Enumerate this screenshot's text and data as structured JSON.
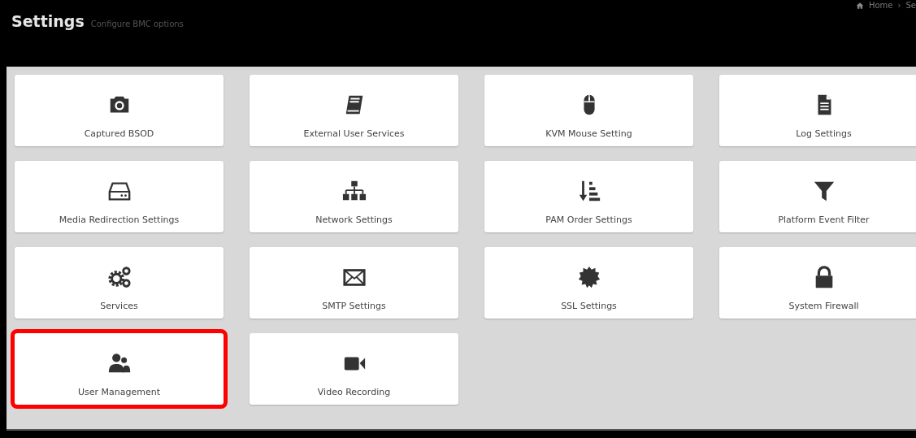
{
  "header": {
    "title": "Settings",
    "subtitle": "Configure BMC options",
    "breadcrumb": [
      "Home",
      "›",
      "Se"
    ]
  },
  "tiles": [
    {
      "label": "Captured BSOD",
      "highlighted": false
    },
    {
      "label": "External User Services",
      "highlighted": false
    },
    {
      "label": "KVM Mouse Setting",
      "highlighted": false
    },
    {
      "label": "Log Settings",
      "highlighted": false
    },
    {
      "label": "Media Redirection Settings",
      "highlighted": false
    },
    {
      "label": "Network Settings",
      "highlighted": false
    },
    {
      "label": "PAM Order Settings",
      "highlighted": false
    },
    {
      "label": "Platform Event Filter",
      "highlighted": false
    },
    {
      "label": "Services",
      "highlighted": false
    },
    {
      "label": "SMTP Settings",
      "highlighted": false
    },
    {
      "label": "SSL Settings",
      "highlighted": false
    },
    {
      "label": "System Firewall",
      "highlighted": false
    },
    {
      "label": "User Management",
      "highlighted": true
    },
    {
      "label": "Video Recording",
      "highlighted": false
    }
  ]
}
